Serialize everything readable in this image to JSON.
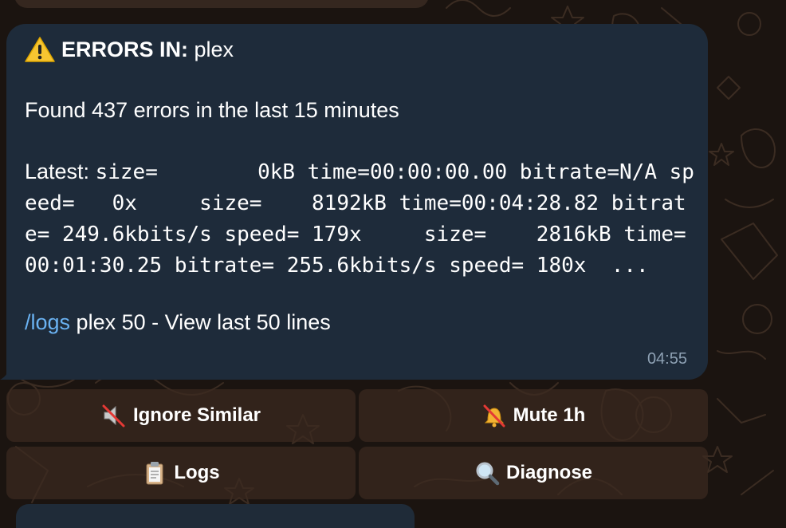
{
  "message": {
    "title_prefix": "ERRORS IN:",
    "title_service": "plex",
    "summary": "Found 437 errors in the last 15 minutes",
    "latest_label": "Latest:",
    "latest_log": "size=        0kB time=00:00:00.00 bitrate=N/A speed=   0x     size=    8192kB time=00:04:28.82 bitrate= 249.6kbits/s speed= 179x     size=    2816kB time=00:01:30.25 bitrate= 255.6kbits/s speed= 180x  ...",
    "command_link": "/logs",
    "command_rest": " plex 50 - View last 50 lines",
    "time": "04:55"
  },
  "keyboard": {
    "ignore_label": "Ignore Similar",
    "mute_label": "Mute 1h",
    "logs_label": "Logs",
    "diagnose_label": "Diagnose"
  },
  "icons": {
    "title": "warning-icon",
    "ignore": "muted-speaker-icon",
    "mute": "bell-slash-icon",
    "logs": "clipboard-icon",
    "diagnose": "magnifier-icon"
  },
  "colors": {
    "bubble": "#1e2b3a",
    "link": "#6ab2f2",
    "timestamp": "#8ea1b4",
    "button": "#3c2a20",
    "wallpaper": "#1b1410"
  }
}
